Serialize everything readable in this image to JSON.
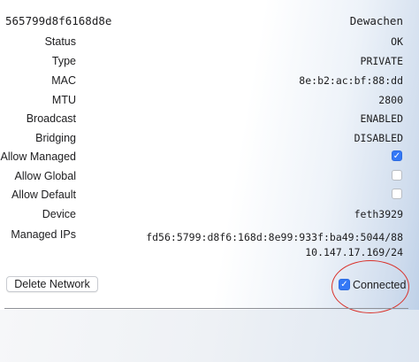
{
  "network": {
    "id": "565799d8f6168d8e",
    "name": "Dewachen"
  },
  "fields": {
    "status": {
      "label": "Status",
      "value": "OK"
    },
    "type": {
      "label": "Type",
      "value": "PRIVATE"
    },
    "mac": {
      "label": "MAC",
      "value": "8e:b2:ac:bf:88:dd"
    },
    "mtu": {
      "label": "MTU",
      "value": "2800"
    },
    "broadcast": {
      "label": "Broadcast",
      "value": "ENABLED"
    },
    "bridging": {
      "label": "Bridging",
      "value": "DISABLED"
    },
    "allow_managed": {
      "label": "Allow Managed",
      "checked": true
    },
    "allow_global": {
      "label": "Allow Global",
      "checked": false
    },
    "allow_default": {
      "label": "Allow Default",
      "checked": false
    },
    "device": {
      "label": "Device",
      "value": "feth3929"
    },
    "managed_ips": {
      "label": "Managed IPs",
      "values": [
        "fd56:5799:d8f6:168d:8e99:933f:ba49:5044/88",
        "10.147.17.169/24"
      ]
    }
  },
  "actions": {
    "delete_label": "Delete Network",
    "connected_label": "Connected",
    "connected_checked": true
  },
  "colors": {
    "accent": "#3478f6",
    "annotation": "#d9322b"
  },
  "icons": {
    "checkmark": "checkmark-icon"
  }
}
